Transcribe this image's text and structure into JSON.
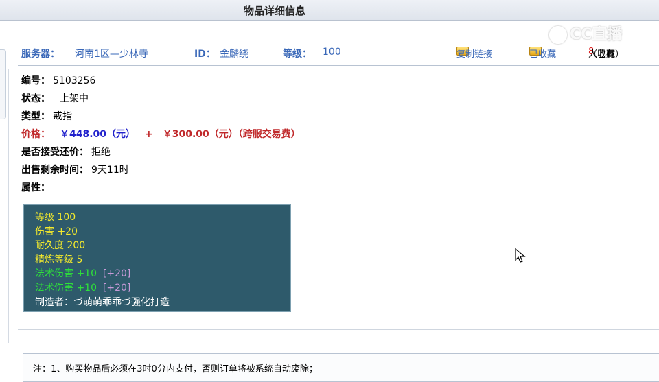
{
  "header": {
    "title": "物品详细信息"
  },
  "watermark": {
    "text": "CC直播"
  },
  "info": {
    "server_label": "服务器：",
    "server_value": "河南1区—少林寺",
    "id_label": "ID：",
    "id_value": "金麟绕",
    "level_label": "等级：",
    "level_value": "100"
  },
  "actions": {
    "copy_link": "复制链接",
    "favorited": "已收藏",
    "collected_prefix": "（已有",
    "collected_count": "8",
    "collected_suffix": "人收藏）"
  },
  "details": {
    "number_label": "编号：",
    "number_value": "5103256",
    "status_label": "状态：",
    "status_value": "上架中",
    "type_label": "类型：",
    "type_value": "戒指",
    "price_label": "价格：",
    "price_value": "￥448.00（元）",
    "price_plus": "+",
    "fee_value": "￥300.00（元）（跨服交易费）",
    "bargain_label": "是否接受还价：",
    "bargain_value": "拒绝",
    "time_label": "出售剩余时间：",
    "time_value": "9天11时",
    "attr_label": "属性："
  },
  "attributes": {
    "level": "等级 100",
    "damage": "伤害 +20",
    "durability": "耐久度 200",
    "refine": "精炼等级 5",
    "magic1_main": "法术伤害 +10",
    "magic1_bonus": "[+20]",
    "magic2_main": "法术伤害 +10",
    "magic2_bonus": "[+20]",
    "maker": "制造者：づ萌萌乖乖づ强化打造"
  },
  "note": {
    "text": "注：1、购买物品后必须在3时0分内支付，否则订单将被系统自动废除；"
  },
  "colors": {
    "label_blue": "#3a68b8",
    "price_red": "#c0282a",
    "price_blue": "#2222cc",
    "attr_bg": "#2e5a6b",
    "attr_yellow": "#f4ea2c",
    "attr_green": "#2ee03a",
    "attr_purple": "#c79bd8"
  },
  "icons": [
    "copy-link-icon",
    "favorite-icon",
    "mouse-cursor-icon",
    "cc-logo-icon"
  ]
}
